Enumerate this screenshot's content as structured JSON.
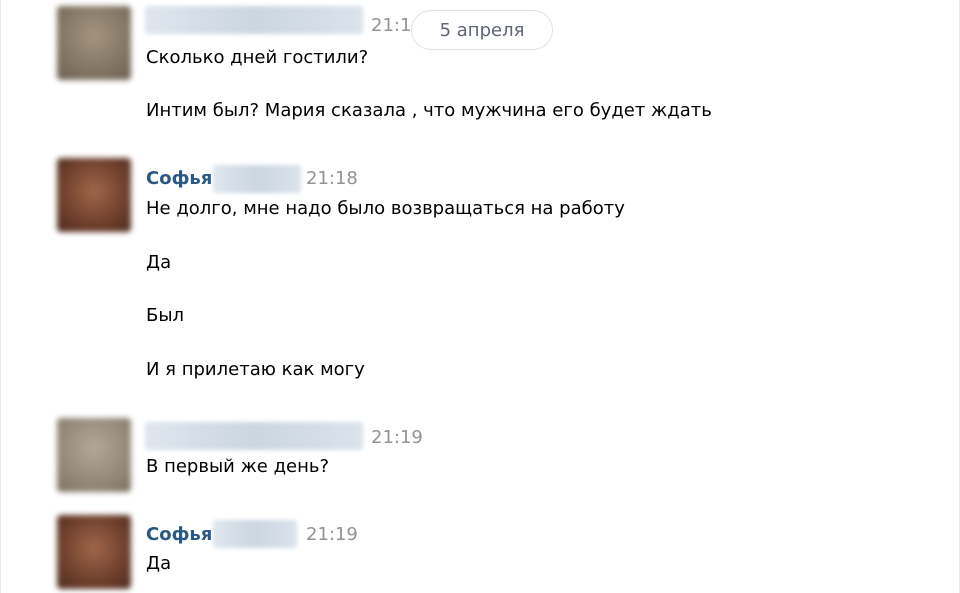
{
  "date_badge": "5 апреля",
  "groups": [
    {
      "time": "21:1",
      "avatar_color": "#8a7c6a",
      "messages": [
        "Сколько дней гостили?",
        "Интим был? Мария сказала , что мужчина его будет ждать"
      ]
    },
    {
      "author": "Софья",
      "time": "21:18",
      "avatar_color": "#7a4a35",
      "messages": [
        "Не долго, мне надо было возвращаться на работу",
        "Да",
        "Был",
        "И я прилетаю как могу"
      ]
    },
    {
      "time": "21:19",
      "avatar_color": "#9a8f80",
      "messages": [
        "В первый же день?"
      ]
    },
    {
      "author": "Софья",
      "time": "21:19",
      "avatar_color": "#7a4a35",
      "messages": [
        "Да"
      ]
    }
  ]
}
